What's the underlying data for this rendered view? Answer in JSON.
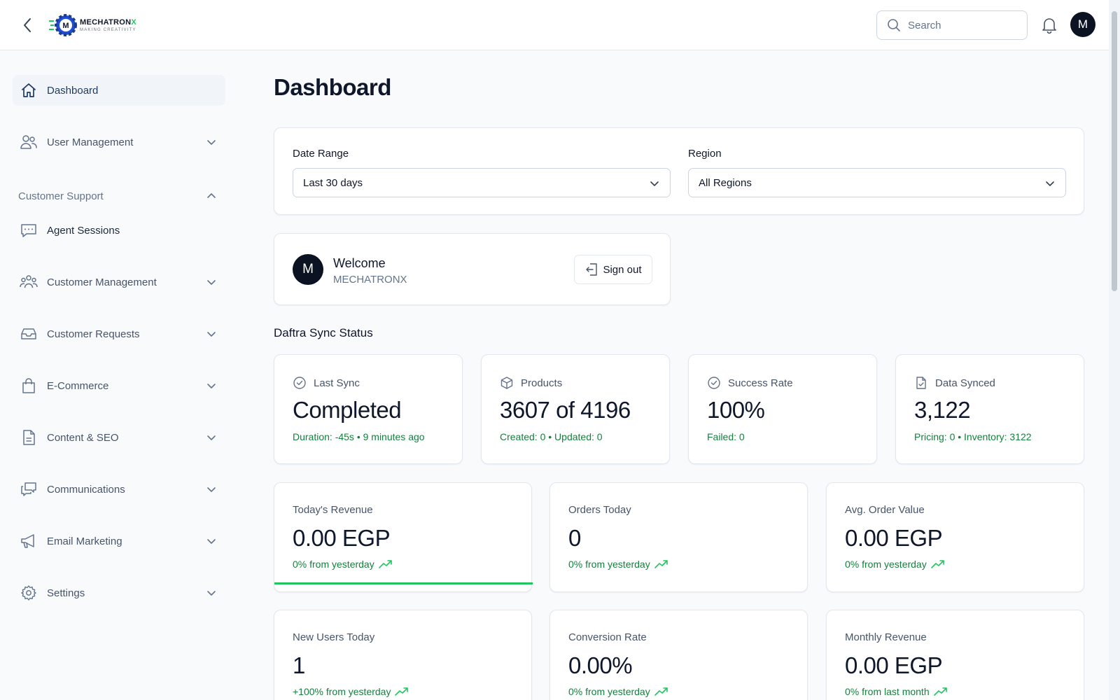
{
  "header": {
    "logo": {
      "name_main": "MECHATRON",
      "name_accent": "X",
      "tagline": "MAKING CREATIVITY"
    },
    "search": {
      "placeholder": "Search",
      "value": ""
    },
    "avatar_initial": "M"
  },
  "sidebar": {
    "dashboard": "Dashboard",
    "user_management": "User Management",
    "customer_support": "Customer Support",
    "agent_sessions": "Agent Sessions",
    "customer_management": "Customer Management",
    "customer_requests": "Customer Requests",
    "ecommerce": "E-Commerce",
    "content_seo": "Content & SEO",
    "communications": "Communications",
    "email_marketing": "Email Marketing",
    "settings": "Settings"
  },
  "page": {
    "title": "Dashboard"
  },
  "filters": {
    "date_range": {
      "label": "Date Range",
      "value": "Last 30 days"
    },
    "region": {
      "label": "Region",
      "value": "All Regions"
    }
  },
  "welcome": {
    "initial": "M",
    "greeting": "Welcome",
    "name": "MECHATRONX",
    "sign_out": "Sign out"
  },
  "sync": {
    "title": "Daftra Sync Status",
    "last_sync": {
      "label": "Last Sync",
      "value": "Completed",
      "sub": "Duration: -45s • 9 minutes ago"
    },
    "products": {
      "label": "Products",
      "value": "3607 of 4196",
      "sub": "Created: 0 • Updated: 0"
    },
    "success_rate": {
      "label": "Success Rate",
      "value": "100%",
      "sub": "Failed: 0"
    },
    "data_synced": {
      "label": "Data Synced",
      "value": "3,122",
      "sub": "Pricing: 0 • Inventory: 3122"
    }
  },
  "metrics": {
    "todays_revenue": {
      "label": "Today's Revenue",
      "value": "0.00 EGP",
      "sub": "0% from yesterday"
    },
    "orders_today": {
      "label": "Orders Today",
      "value": "0",
      "sub": "0% from yesterday"
    },
    "avg_order_value": {
      "label": "Avg. Order Value",
      "value": "0.00 EGP",
      "sub": "0% from yesterday"
    },
    "new_users_today": {
      "label": "New Users Today",
      "value": "1",
      "sub": "+100% from yesterday"
    },
    "conversion_rate": {
      "label": "Conversion Rate",
      "value": "0.00%",
      "sub": "0% from yesterday"
    },
    "monthly_revenue": {
      "label": "Monthly Revenue",
      "value": "0.00 EGP",
      "sub": "0% from last month"
    }
  },
  "colors": {
    "accent_green": "#22c55e",
    "positive_text": "#15803d",
    "dark": "#0b1222"
  }
}
